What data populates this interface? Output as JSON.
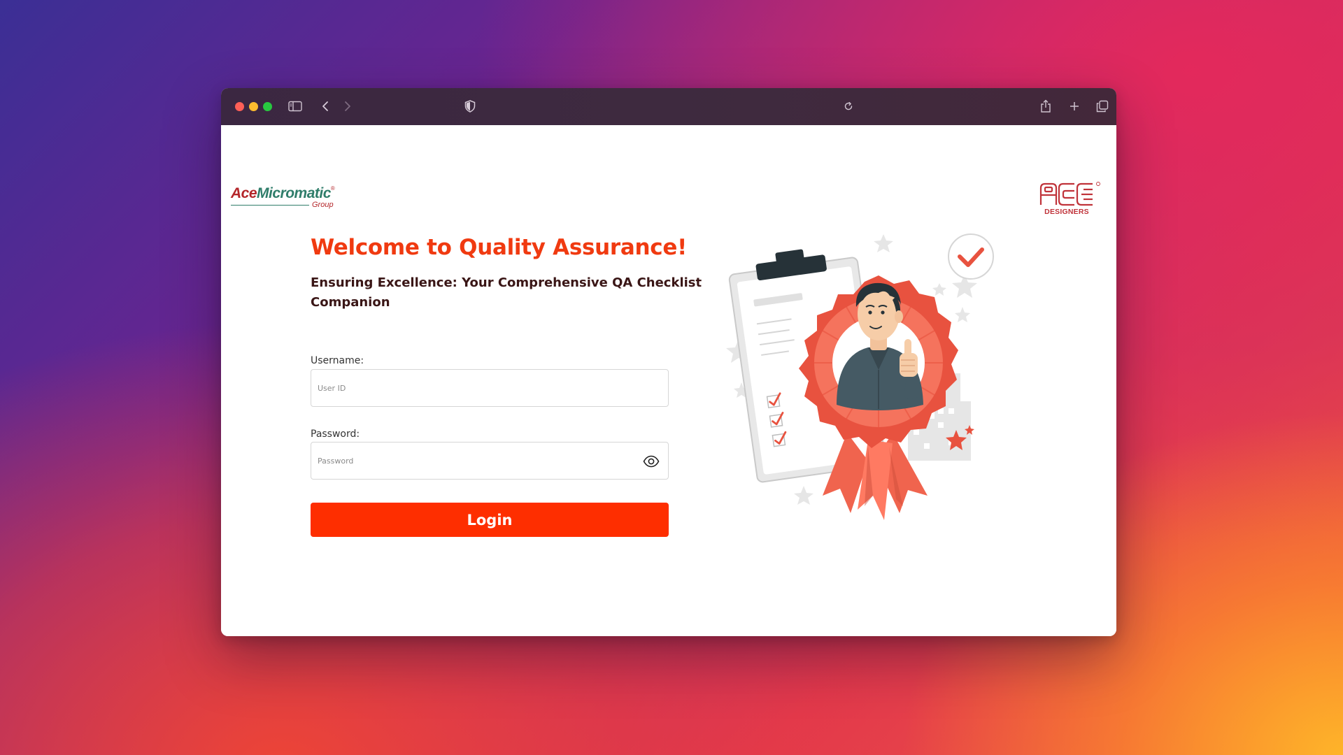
{
  "browser": {
    "toolbar_icons": [
      "sidebar-icon",
      "back-icon",
      "forward-icon",
      "shield-icon",
      "reload-icon",
      "share-icon",
      "new-tab-icon",
      "tabs-overview-icon"
    ]
  },
  "brands": {
    "left": {
      "ace": "Ace",
      "micromatic": "Micromatic",
      "group": "Group",
      "registered": "®"
    },
    "right": {
      "letters": "ACE",
      "designers": "DESIGNERS",
      "registered": "®"
    }
  },
  "login": {
    "title": "Welcome to Quality Assurance!",
    "subtitle": "Ensuring Excellence: Your Comprehensive QA Checklist Companion",
    "username_label": "Username:",
    "username_placeholder": "User ID",
    "username_value": "",
    "password_label": "Password:",
    "password_placeholder": "Password",
    "password_value": "",
    "login_button": "Login"
  },
  "colors": {
    "accent": "#fe2e00",
    "title": "#f03a10",
    "subtitle": "#3a1616",
    "titlebar": "#3e2a3f"
  }
}
